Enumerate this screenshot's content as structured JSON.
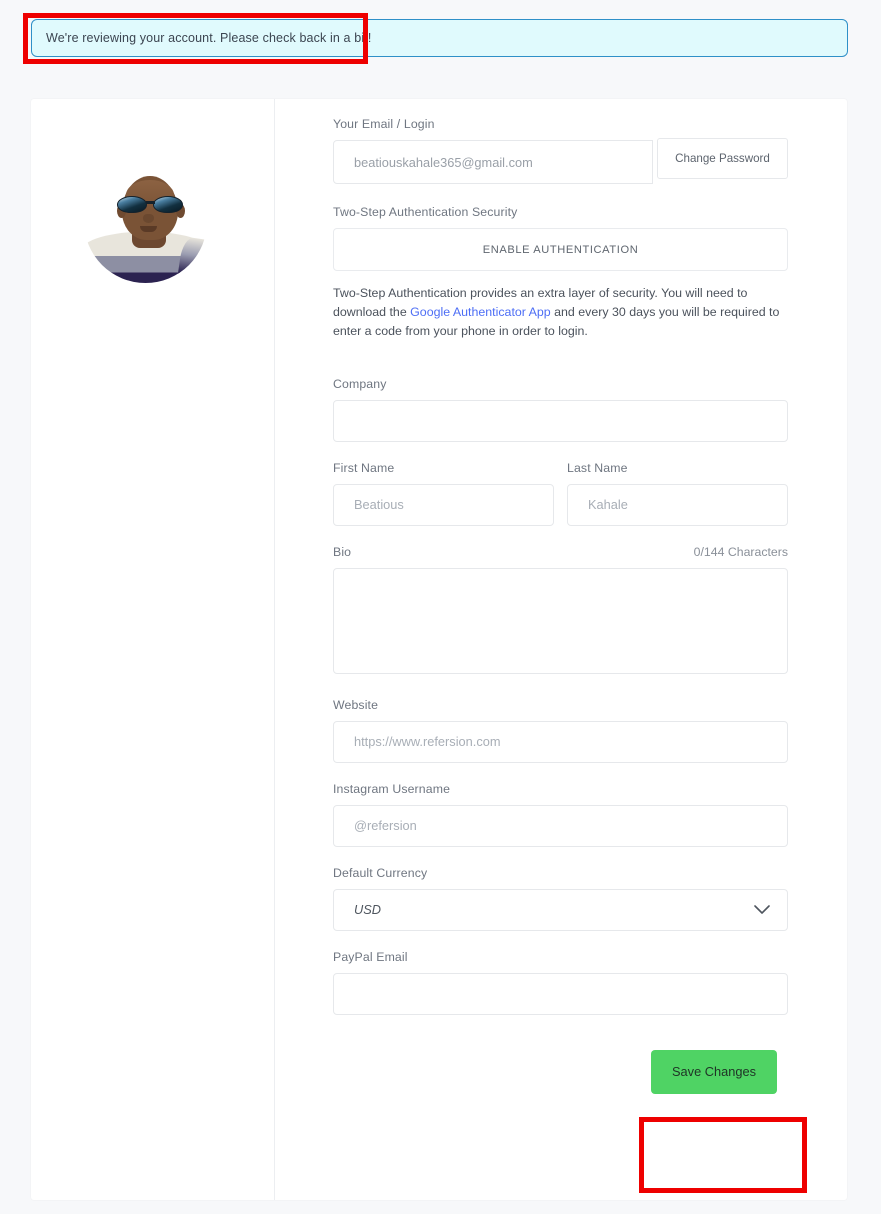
{
  "banner": {
    "message": "We're reviewing your account. Please check back in a bit!",
    "bg_color": "#e0fafd",
    "border_color": "#2f90c8"
  },
  "annotations": {
    "color": "#ee0000",
    "targets": [
      "review-banner",
      "save-changes-button"
    ]
  },
  "avatar": {
    "alt": "profile-photo"
  },
  "form": {
    "email": {
      "label": "Your Email / Login",
      "value": "beatiouskahale365@gmail.com",
      "change_password_label": "Change Password"
    },
    "two_step": {
      "label": "Two-Step Authentication Security",
      "button_label": "ENABLE AUTHENTICATION",
      "description_before": "Two-Step Authentication provides an extra layer of security. You will need to download the ",
      "link_text": "Google Authenticator App",
      "link_color": "#4d6ef5",
      "description_after": " and every 30 days you will be required to enter a code from your phone in order to login."
    },
    "company": {
      "label": "Company",
      "value": "",
      "placeholder": ""
    },
    "first_name": {
      "label": "First Name",
      "value": "",
      "placeholder": "Beatious"
    },
    "last_name": {
      "label": "Last Name",
      "value": "",
      "placeholder": "Kahale"
    },
    "bio": {
      "label": "Bio",
      "char_count": "0/144 Characters",
      "value": "",
      "placeholder": ""
    },
    "website": {
      "label": "Website",
      "value": "",
      "placeholder": "https://www.refersion.com"
    },
    "instagram": {
      "label": "Instagram Username",
      "value": "",
      "placeholder": "@refersion"
    },
    "currency": {
      "label": "Default Currency",
      "selected": "USD",
      "icon": "chevron-down-icon"
    },
    "paypal": {
      "label": "PayPal Email",
      "value": "",
      "placeholder": ""
    },
    "save": {
      "label": "Save Changes",
      "color": "#4fd364"
    }
  }
}
